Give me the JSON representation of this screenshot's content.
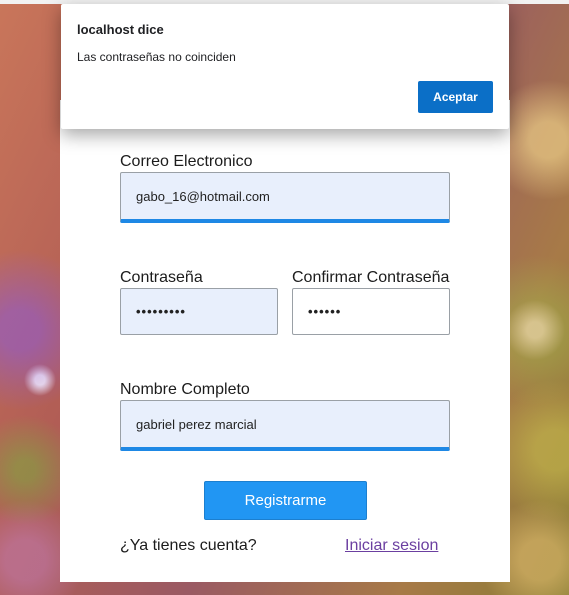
{
  "dialog": {
    "title": "localhost dice",
    "message": "Las contraseñas no coinciden",
    "accept_label": "Aceptar"
  },
  "form": {
    "email_label": "Correo Electronico",
    "email_value": "gabo_16@hotmail.com",
    "password_label": "Contraseña",
    "password_mask": "•••••••••",
    "confirm_label": "Confirmar Contraseña",
    "confirm_mask": "••••••",
    "name_label": "Nombre Completo",
    "name_value": "gabriel perez marcial",
    "submit_label": "Registrarme",
    "account_question": "¿Ya tienes cuenta?",
    "login_link": "Iniciar sesion"
  },
  "colors": {
    "accent": "#2196f3",
    "dialog_button": "#0b6fc7",
    "field_fill": "#e8effc",
    "link": "#6b3fa0"
  }
}
